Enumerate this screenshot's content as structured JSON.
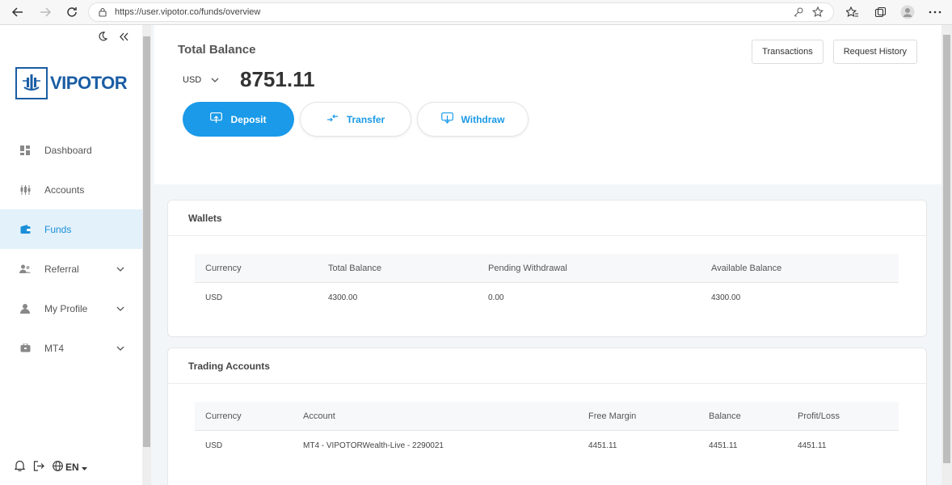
{
  "browser": {
    "url": "https://user.vipotor.co/funds/overview"
  },
  "brand": {
    "name": "VIPOTOR",
    "color": "#1a5da3"
  },
  "sidebar": {
    "items": [
      {
        "label": "Dashboard",
        "icon": "dashboard-icon",
        "active": false
      },
      {
        "label": "Accounts",
        "icon": "accounts-icon",
        "active": false
      },
      {
        "label": "Funds",
        "icon": "wallet-icon",
        "active": true
      },
      {
        "label": "Referral",
        "icon": "referral-icon",
        "active": false
      },
      {
        "label": "My Profile",
        "icon": "user-icon",
        "active": false
      },
      {
        "label": "MT4",
        "icon": "mt4-icon",
        "active": false
      }
    ],
    "language": "EN"
  },
  "balance": {
    "title": "Total Balance",
    "currency": "USD",
    "amount": "8751.11",
    "deposit_label": "Deposit",
    "transfer_label": "Transfer",
    "withdraw_label": "Withdraw",
    "transactions_label": "Transactions",
    "request_history_label": "Request History"
  },
  "wallets": {
    "title": "Wallets",
    "headers": [
      "Currency",
      "Total Balance",
      "Pending Withdrawal",
      "Available Balance"
    ],
    "rows": [
      [
        "USD",
        "4300.00",
        "0.00",
        "4300.00"
      ]
    ]
  },
  "trading": {
    "title": "Trading Accounts",
    "headers": [
      "Currency",
      "Account",
      "Free Margin",
      "Balance",
      "Profit/Loss"
    ],
    "rows": [
      [
        "USD",
        "MT4 - VIPOTORWealth-Live - 2290021",
        "4451.11",
        "4451.11",
        "4451.11"
      ]
    ]
  },
  "colors": {
    "accent": "#1a9ae8",
    "active_bg": "#e3f1fb"
  }
}
